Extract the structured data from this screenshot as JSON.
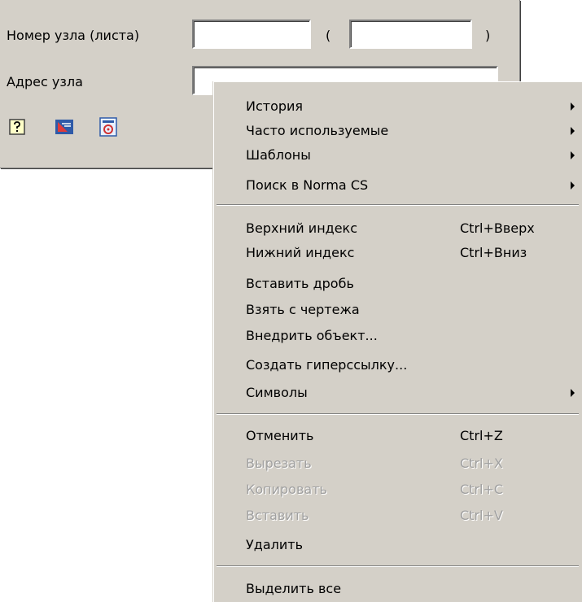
{
  "form": {
    "node_number_label": "Номер узла (листа)",
    "node_number_value": "",
    "paren_open": "(",
    "sheet_value": "",
    "paren_close": ")",
    "node_address_label": "Адрес узла",
    "node_address_value": ""
  },
  "toolbar": {
    "icons": [
      "help-icon",
      "drawing-icon",
      "gost-standard-icon"
    ]
  },
  "context_menu": {
    "items": [
      {
        "label": "История",
        "submenu": true,
        "enabled": true
      },
      {
        "label": "Часто используемые",
        "submenu": true,
        "enabled": true
      },
      {
        "label": "Шаблоны",
        "submenu": true,
        "enabled": true
      },
      {
        "label": "Поиск в Norma CS",
        "submenu": true,
        "enabled": true
      },
      {
        "label": "Верхний индекс",
        "shortcut": "Ctrl+Вверх",
        "enabled": true
      },
      {
        "label": "Нижний индекс",
        "shortcut": "Ctrl+Вниз",
        "enabled": true
      },
      {
        "label": "Вставить дробь",
        "enabled": true
      },
      {
        "label": "Взять с чертежа",
        "enabled": true
      },
      {
        "label": "Внедрить объект...",
        "enabled": true
      },
      {
        "label": "Создать гиперссылку...",
        "enabled": true
      },
      {
        "label": "Символы",
        "submenu": true,
        "enabled": true
      },
      {
        "label": "Отменить",
        "shortcut": "Ctrl+Z",
        "enabled": true
      },
      {
        "label": "Вырезать",
        "shortcut": "Ctrl+X",
        "enabled": false
      },
      {
        "label": "Копировать",
        "shortcut": "Ctrl+C",
        "enabled": false
      },
      {
        "label": "Вставить",
        "shortcut": "Ctrl+V",
        "enabled": false
      },
      {
        "label": "Удалить",
        "enabled": true
      },
      {
        "label": "Выделить все",
        "enabled": true
      }
    ]
  }
}
